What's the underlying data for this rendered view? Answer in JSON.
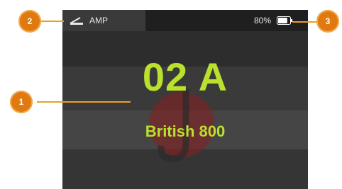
{
  "status_bar": {
    "mode_icon": "amp-icon",
    "mode_label": "AMP",
    "battery_text": "80%",
    "battery_icon": "battery-icon",
    "battery_level": 0.8
  },
  "preset": {
    "number": "02 A",
    "name": "British 800"
  },
  "callouts": [
    {
      "label": "1"
    },
    {
      "label": "2"
    },
    {
      "label": "3"
    }
  ],
  "colors": {
    "accent": "#b9e12e",
    "callout": "#e07a10",
    "callout_line": "#e8a020",
    "watermark": "#8a1e1e"
  }
}
